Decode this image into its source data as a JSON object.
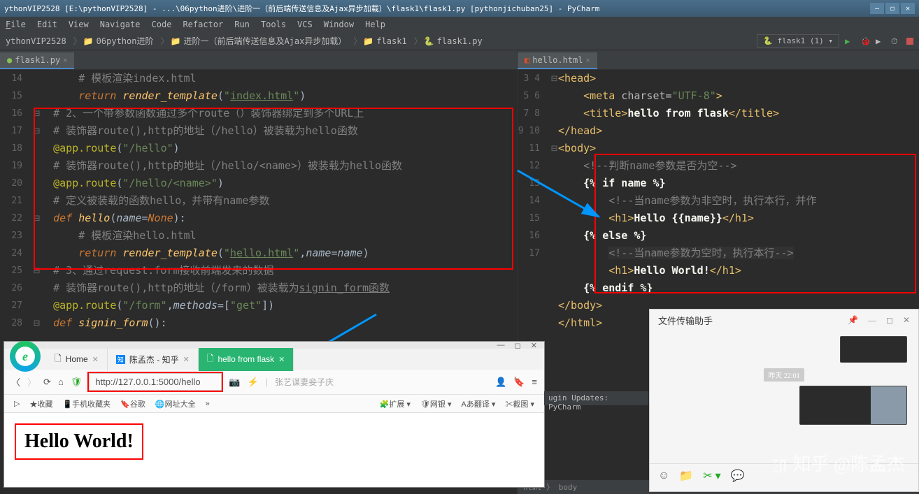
{
  "window": {
    "title": "ythonVIP2528 [E:\\pythonVIP2528] - ...\\06python进阶\\进阶一（前后端传送信息及Ajax异步加载）\\flask1\\flask1.py [pythonjichuban25] - PyCharm"
  },
  "menu": {
    "file": "File",
    "edit": "Edit",
    "view": "View",
    "navigate": "Navigate",
    "code": "Code",
    "refactor": "Refactor",
    "run": "Run",
    "tools": "Tools",
    "vcs": "VCS",
    "window": "Window",
    "help": "Help"
  },
  "breadcrumbs": {
    "root": "ythonVIP2528",
    "p1": "06python进阶",
    "p2": "进阶一（前后端传送信息及Ajax异步加载）",
    "p3": "flask1",
    "p4": "flask1.py"
  },
  "run_config": "flask1 (1) ▾",
  "tabs": {
    "left": "flask1.py",
    "right": "hello.html"
  },
  "left_lines": [
    "14",
    "15",
    "16",
    "17",
    "18",
    "19",
    "20",
    "21",
    "22",
    "23",
    "24",
    "25",
    "26",
    "27",
    "28"
  ],
  "right_lines": [
    "3",
    "4",
    "5",
    "6",
    "7",
    "8",
    "9",
    "10",
    "11",
    "12",
    "13",
    "14",
    "15",
    "16",
    "17"
  ],
  "left_code": {
    "l14": "# 模板渲染index.html",
    "l15_kw": "return",
    "l15_fn": "render_template",
    "l15_str": "\"",
    "l15_arg": "index.html",
    "l16": "# 2、一个带参数函数通过多个route（）装饰器绑定到多个URL上",
    "l17": "# 装饰器route(),http的地址（/hello）被装载为hello函数",
    "l18_dec": "@app.route",
    "l18_arg": "\"/hello\"",
    "l19": "# 装饰器route(),http的地址（/hello/<name>）被装载为hello函数",
    "l20_dec": "@app.route",
    "l20_arg": "\"/hello/<name>\"",
    "l21": "# 定义被装载的函数hello，并带有name参数",
    "l22_kw": "def ",
    "l22_fn": "hello",
    "l22_p": "name",
    "l22_none": "None",
    "l23": "# 模板渲染hello.html",
    "l24_kw": "return",
    "l24_fn": "render_template",
    "l24_str": "\"",
    "l24_arg": "hello.html",
    "l24_p": "name",
    "l24_v": "name",
    "l25": "# 3、通过request.form接收前端发来的数据",
    "l26": "# 装饰器route(),http的地址（/form）被装载为",
    "l26b": "signin_form函数",
    "l27_dec": "@app.route",
    "l27_arg": "\"/form\"",
    "l27_m": "methods",
    "l27_get": "\"get\"",
    "l28_kw": "def ",
    "l28_fn": "signin_form"
  },
  "right_code": {
    "l3": "head",
    "l4_tag": "meta",
    "l4_attr": "charset",
    "l4_val": "\"UTF-8\"",
    "l5_open": "title",
    "l5_txt": "hello from flask",
    "l6": "/head",
    "l7": "body",
    "l8": "<!--判断name参数是否为空-->",
    "l9": "{% if name %}",
    "l10": "<!--当name参数为非空时，执行本行，并作",
    "l11_open": "h1",
    "l11_txt": "Hello {{name}}",
    "l12": "{% else %}",
    "l13": "<!--当name参数为空时，执行本行-->",
    "l14_open": "h1",
    "l14_txt": "Hello World!",
    "l15": "{% endif %}",
    "l16": "/body",
    "l17": "/html"
  },
  "right_crumbs": "html 〉 body",
  "browser": {
    "tab1": "Home",
    "tab2": "陈孟杰 - 知乎",
    "tab3": "hello from flask",
    "url": "http://127.0.0.1:5000/hello",
    "search_ph": "张艺谋妻妾子庆",
    "bm_fav": "收藏",
    "bm_mobile": "手机收藏夹",
    "bm_google": "谷歌",
    "bm_sites": "网址大全",
    "tb_ext": "扩展",
    "tb_bank": "网银",
    "tb_trans": "翻译",
    "tb_cap": "截图",
    "content": "Hello World!"
  },
  "status": "ugin Updates: PyCharm",
  "wechat": {
    "title": "文件传输助手",
    "time": "昨天 22:01"
  },
  "watermark": "知乎 @陈孟杰"
}
